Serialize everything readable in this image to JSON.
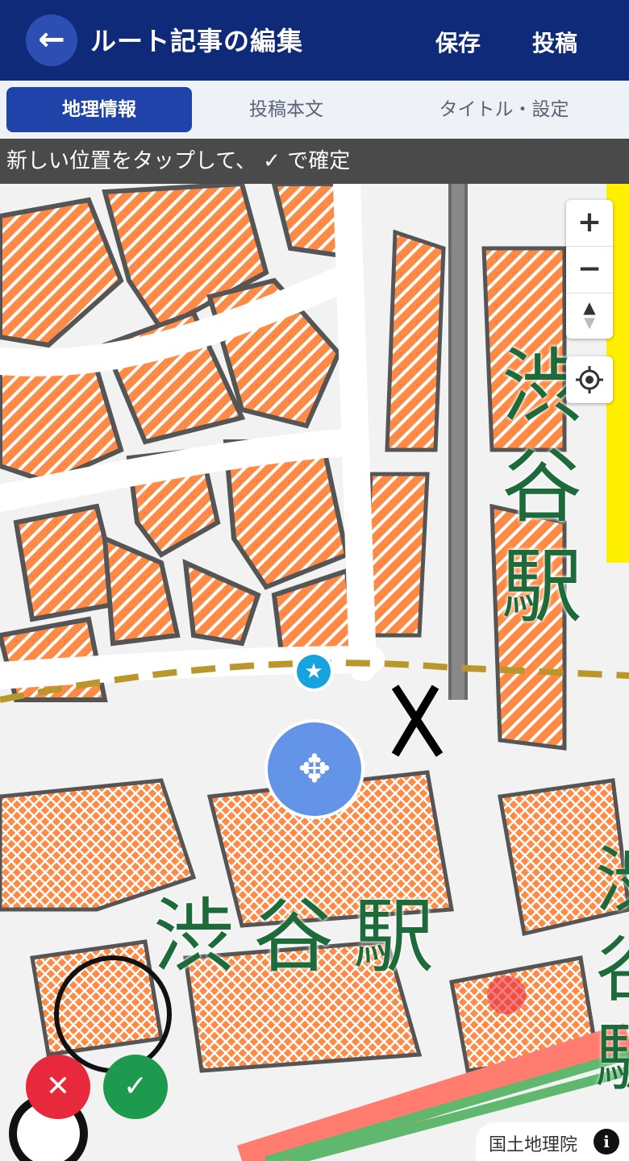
{
  "header": {
    "back_icon": "arrow-left-icon",
    "title": "ルート記事の編集",
    "save_label": "保存",
    "post_label": "投稿"
  },
  "tabs": [
    {
      "label": "地理情報",
      "active": true
    },
    {
      "label": "投稿本文",
      "active": false
    },
    {
      "label": "タイトル・設定",
      "active": false
    }
  ],
  "banner": {
    "text": "新しい位置をタップして、 ✓ で確定"
  },
  "map": {
    "station_label_large": "渋谷駅",
    "station_label_vertical": [
      "渋",
      "谷",
      "駅"
    ],
    "station_label_edge": [
      "渋",
      "谷",
      "駅"
    ],
    "move_marker_icon": "move-arrows-icon",
    "pin_icon": "star-pin-icon",
    "zoom_in": "+",
    "zoom_out": "−",
    "compass": "▲",
    "locate_icon": "crosshair-icon",
    "cancel_icon": "close-icon",
    "confirm_icon": "check-icon",
    "attribution": "国土地理院",
    "info_icon": "i"
  },
  "colors": {
    "header_bg": "#102a7a",
    "tab_active_bg": "#1f43a8",
    "building": "#ff8a45",
    "station_text": "#1d6b3a",
    "cancel": "#e8283b",
    "confirm": "#1e9a4f",
    "marker": "#5b8ee6"
  }
}
